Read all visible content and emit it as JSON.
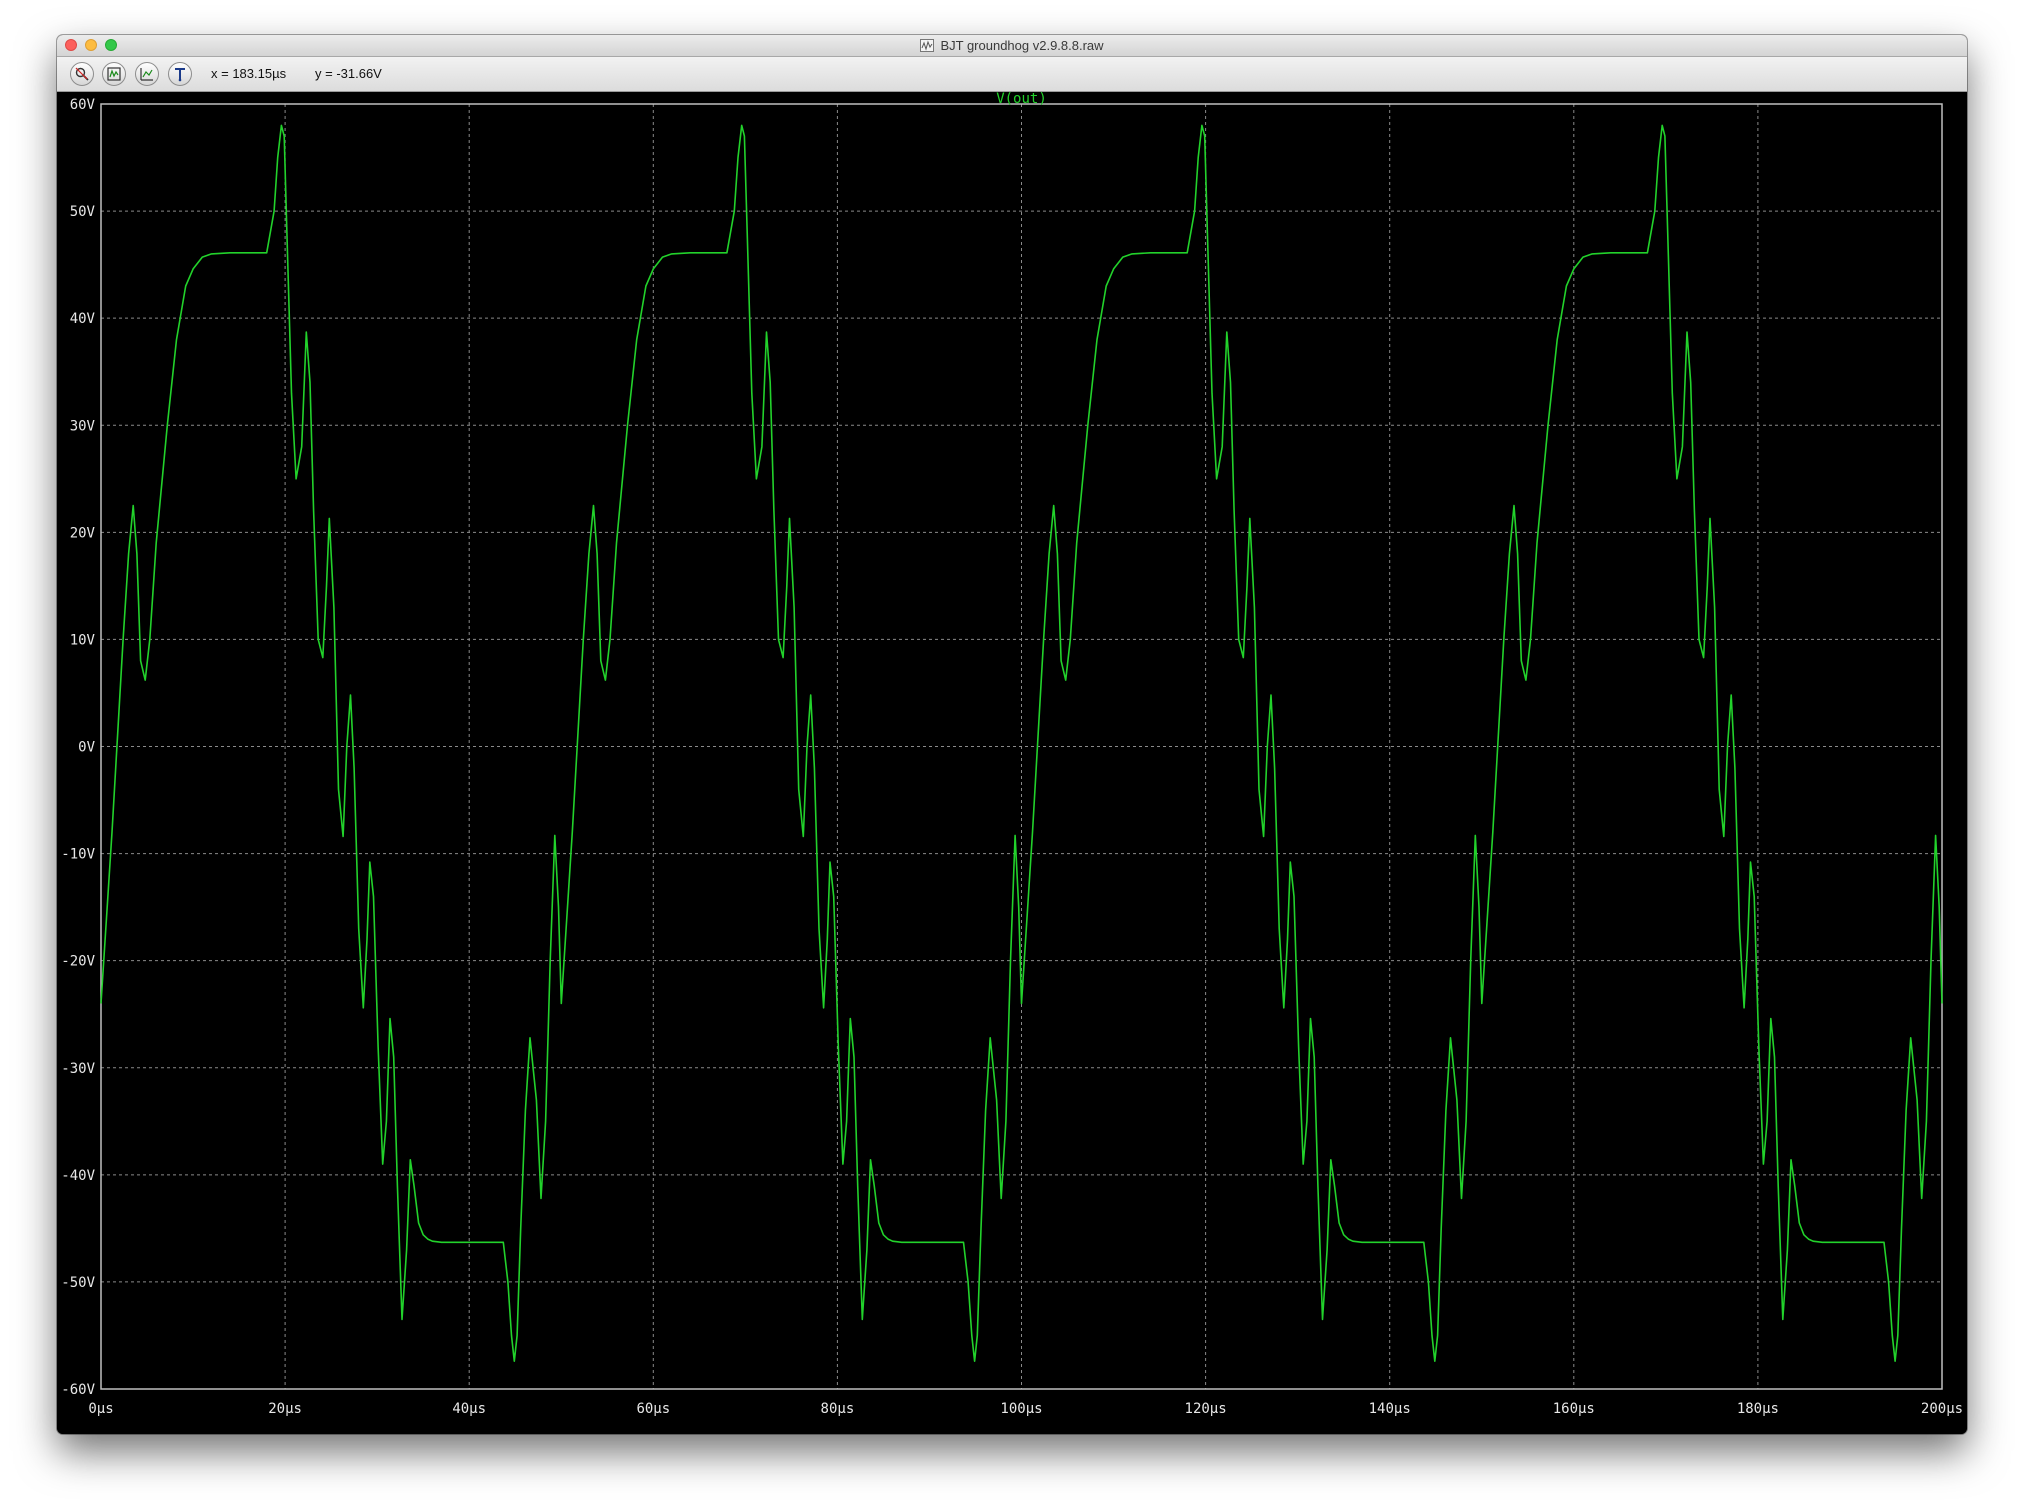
{
  "window": {
    "title": "BJT groundhog v2.9.8.8.raw"
  },
  "toolbar": {
    "buttons": [
      {
        "name": "zoom-tool-button",
        "icon": "magnifier-cross-icon"
      },
      {
        "name": "autorange-button",
        "icon": "autorange-icon"
      },
      {
        "name": "cursor-button",
        "icon": "cursor-icon"
      },
      {
        "name": "probe-button",
        "icon": "probe-icon"
      }
    ],
    "cursor_x": "x = 183.15µs",
    "cursor_y": "y = -31.66V"
  },
  "colors": {
    "trace": "#22d22b",
    "grid": "#8a8a8a",
    "axis_text": "#e8e8e8",
    "background": "#000000"
  },
  "chart_data": {
    "type": "line",
    "title": "V(out)",
    "xlabel": "",
    "ylabel": "",
    "xlim": [
      0,
      200
    ],
    "ylim": [
      -60,
      60
    ],
    "grid": true,
    "x_ticks": [
      "0µs",
      "20µs",
      "40µs",
      "60µs",
      "80µs",
      "100µs",
      "120µs",
      "140µs",
      "160µs",
      "180µs",
      "200µs"
    ],
    "y_ticks": [
      "60V",
      "50V",
      "40V",
      "30V",
      "20V",
      "10V",
      "0V",
      "-10V",
      "-20V",
      "-30V",
      "-40V",
      "-50V",
      "-60V"
    ],
    "period_us": 50,
    "series": [
      {
        "name": "V(out)",
        "note_units": "x in µs, y in V; one period shown, repeated across 0-200 µs",
        "x": [
          0,
          1.2,
          2.4,
          3.0,
          3.5,
          3.9,
          4.3,
          4.8,
          5.3,
          6.0,
          7.2,
          8.2,
          9.2,
          10.0,
          11.0,
          12.0,
          14.0,
          16.0,
          18.0,
          18.8,
          19.2,
          19.6,
          19.9,
          20.2,
          20.7,
          21.2,
          21.8,
          22.3,
          22.7,
          23.1,
          23.6,
          24.1,
          24.5,
          24.8,
          25.3,
          25.8,
          26.3,
          26.7,
          27.1,
          27.5,
          28.0,
          28.5,
          28.9,
          29.2,
          29.6,
          30.1,
          30.6,
          31.0,
          31.4,
          31.8,
          32.2,
          32.7,
          33.2,
          33.6,
          34.0,
          34.5,
          35.0,
          35.5,
          36.0,
          37.0,
          38.0,
          40.0,
          42.0,
          43.7,
          44.2,
          44.6,
          44.9,
          45.2,
          45.6,
          46.1,
          46.6,
          47.3,
          47.8,
          48.3,
          48.8,
          49.3,
          49.7,
          50.0
        ],
        "y": [
          -24,
          -8,
          10,
          18,
          22.5,
          18,
          8,
          6.2,
          10,
          19,
          30,
          38,
          43,
          44.6,
          45.7,
          46,
          46.1,
          46.1,
          46.1,
          50,
          55,
          58,
          57,
          48,
          33,
          25,
          28,
          38.7,
          34,
          22,
          10,
          8.3,
          15,
          21.3,
          13,
          -4,
          -8.4,
          0,
          4.8,
          -2,
          -17,
          -24.4,
          -18,
          -10.8,
          -14,
          -28,
          -39,
          -35,
          -25.4,
          -29,
          -41,
          -53.5,
          -47,
          -38.6,
          -41,
          -44.5,
          -45.6,
          -46,
          -46.2,
          -46.3,
          -46.3,
          -46.3,
          -46.3,
          -46.3,
          -50,
          -55,
          -57.4,
          -55,
          -45,
          -34,
          -27.2,
          -33,
          -42.2,
          -35,
          -20,
          -8.3,
          -15,
          -24
        ]
      }
    ]
  }
}
